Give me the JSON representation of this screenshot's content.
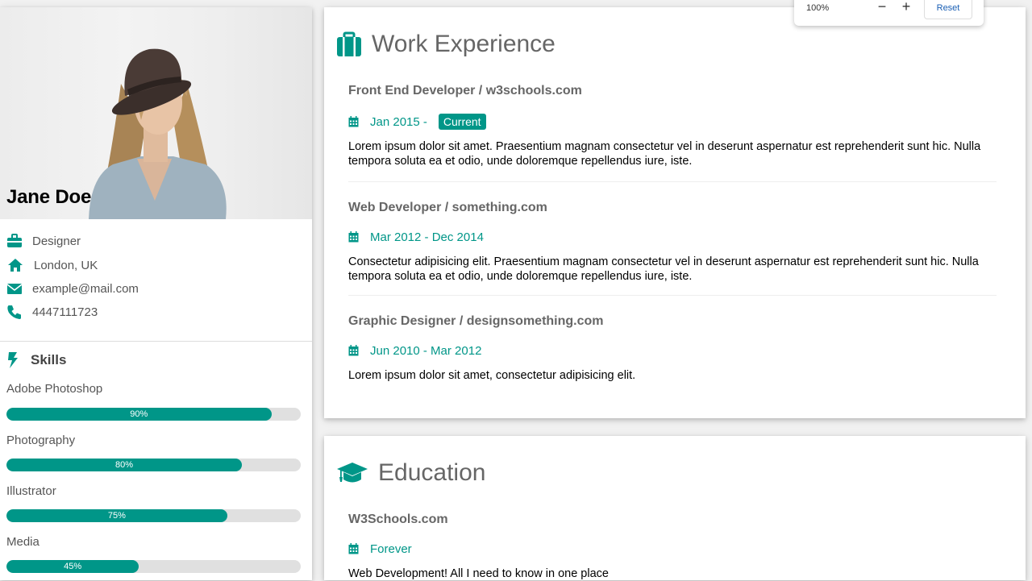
{
  "profile": {
    "name": "Jane Doe",
    "job": "Designer",
    "location": "London, UK",
    "email": "example@mail.com",
    "phone": "4447111723"
  },
  "skills": {
    "heading": "Skills",
    "items": [
      {
        "label": "Adobe Photoshop",
        "percent": 90,
        "text": "90%"
      },
      {
        "label": "Photography",
        "percent": 80,
        "text": "80%"
      },
      {
        "label": "Illustrator",
        "percent": 75,
        "text": "75%"
      },
      {
        "label": "Media",
        "percent": 45,
        "text": "45%"
      }
    ]
  },
  "work": {
    "heading": "Work Experience",
    "entries": [
      {
        "title": "Front End Developer / w3schools.com",
        "date": "Jan 2015 -",
        "badge": "Current",
        "text": "Lorem ipsum dolor sit amet. Praesentium magnam consectetur vel in deserunt aspernatur est reprehenderit sunt hic. Nulla tempora soluta ea et odio, unde doloremque repellendus iure, iste."
      },
      {
        "title": "Web Developer / something.com",
        "date": "Mar 2012 - Dec 2014",
        "text": "Consectetur adipisicing elit. Praesentium magnam consectetur vel in deserunt aspernatur est reprehenderit sunt hic. Nulla tempora soluta ea et odio, unde doloremque repellendus iure, iste."
      },
      {
        "title": "Graphic Designer / designsomething.com",
        "date": "Jun 2010 - Mar 2012",
        "text": "Lorem ipsum dolor sit amet, consectetur adipisicing elit."
      }
    ]
  },
  "education": {
    "heading": "Education",
    "entries": [
      {
        "title": "W3Schools.com",
        "date": "Forever",
        "text": "Web Development! All I need to know in one place"
      }
    ]
  },
  "zoom": {
    "level": "100%",
    "minus": "−",
    "plus": "+",
    "reset_label": "Reset"
  },
  "colors": {
    "accent": "#009688",
    "bar_bg": "#e0e0e0",
    "page_bg": "#f1f1f1"
  },
  "icons": {
    "job": "briefcase-icon",
    "location": "home-icon",
    "email": "envelope-icon",
    "phone": "phone-icon",
    "skills": "bolt-icon",
    "work": "suitcase-icon",
    "education": "graduation-cap-icon",
    "date": "calendar-icon"
  }
}
